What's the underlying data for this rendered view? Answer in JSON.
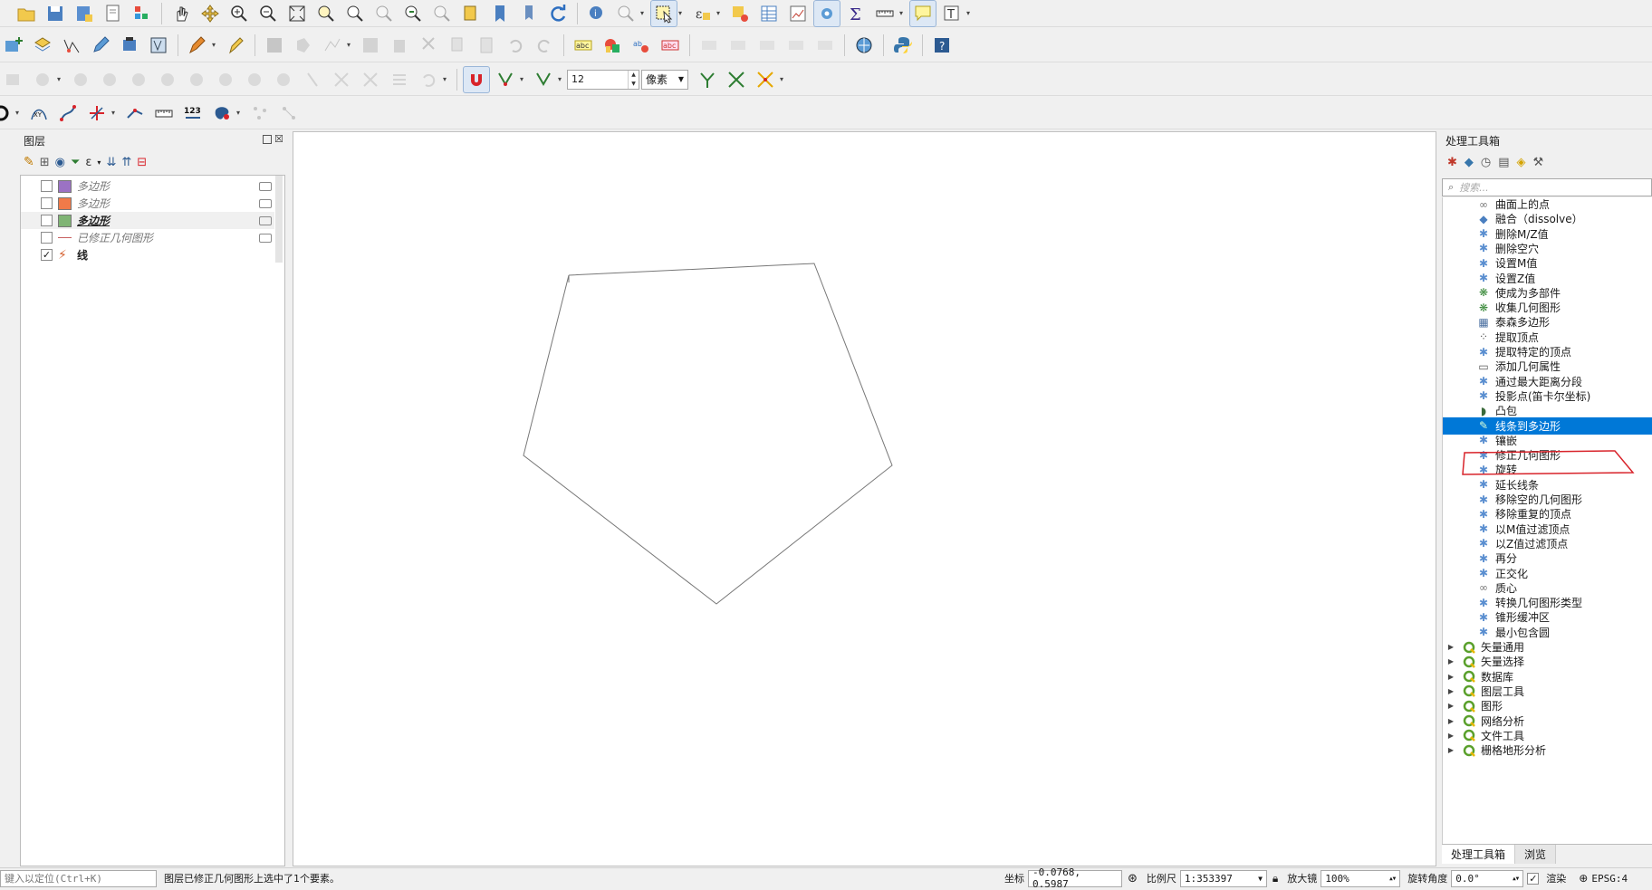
{
  "toolbar": {
    "snap_tolerance": "12",
    "snap_unit": "像素"
  },
  "layers_panel": {
    "title": "图层",
    "layers": [
      {
        "name": "多边形",
        "checked": false,
        "color": "#9b72c4",
        "style": "italic"
      },
      {
        "name": "多边形",
        "checked": false,
        "color": "#f07a49",
        "style": "italic"
      },
      {
        "name": "多边形",
        "checked": false,
        "color": "#7fb474",
        "style": "bold"
      },
      {
        "name": "已修正几何图形",
        "checked": false,
        "color": "#c86060",
        "style": "italic-line"
      },
      {
        "name": "线",
        "checked": true,
        "color": "#d45f2e",
        "style": "solid"
      }
    ]
  },
  "processing": {
    "title": "处理工具箱",
    "search_placeholder": "搜索...",
    "algorithms": [
      {
        "label": "曲面上的点",
        "icon": "chain-icon"
      },
      {
        "label": "融合（dissolve）",
        "icon": "dissolve-icon"
      },
      {
        "label": "删除M/Z值",
        "icon": "gear-icon"
      },
      {
        "label": "删除空穴",
        "icon": "gear-icon"
      },
      {
        "label": "设置M值",
        "icon": "gear-icon"
      },
      {
        "label": "设置Z值",
        "icon": "gear-icon"
      },
      {
        "label": "使成为多部件",
        "icon": "multipart-icon"
      },
      {
        "label": "收集几何图形",
        "icon": "collect-icon"
      },
      {
        "label": "泰森多边形",
        "icon": "voronoi-icon"
      },
      {
        "label": "提取顶点",
        "icon": "vertices-icon"
      },
      {
        "label": "提取特定的顶点",
        "icon": "gear-icon"
      },
      {
        "label": "添加几何属性",
        "icon": "attribute-icon"
      },
      {
        "label": "通过最大距离分段",
        "icon": "gear-icon"
      },
      {
        "label": "投影点(笛卡尔坐标)",
        "icon": "gear-icon"
      },
      {
        "label": "凸包",
        "icon": "convex-hull-icon"
      },
      {
        "label": "线条到多边形",
        "icon": "lines-to-polygon-icon",
        "selected": true
      },
      {
        "label": "镶嵌",
        "icon": "gear-icon"
      },
      {
        "label": "修正几何图形",
        "icon": "gear-icon"
      },
      {
        "label": "旋转",
        "icon": "gear-icon"
      },
      {
        "label": "延长线条",
        "icon": "gear-icon"
      },
      {
        "label": "移除空的几何图形",
        "icon": "gear-icon"
      },
      {
        "label": "移除重复的顶点",
        "icon": "gear-icon"
      },
      {
        "label": "以M值过滤顶点",
        "icon": "gear-icon"
      },
      {
        "label": "以Z值过滤顶点",
        "icon": "gear-icon"
      },
      {
        "label": "再分",
        "icon": "gear-icon"
      },
      {
        "label": "正交化",
        "icon": "gear-icon"
      },
      {
        "label": "质心",
        "icon": "chain-icon"
      },
      {
        "label": "转换几何图形类型",
        "icon": "gear-icon"
      },
      {
        "label": "锥形缓冲区",
        "icon": "gear-icon"
      },
      {
        "label": "最小包含圆",
        "icon": "gear-icon"
      }
    ],
    "groups": [
      {
        "label": "矢量通用"
      },
      {
        "label": "矢量选择"
      },
      {
        "label": "数据库"
      },
      {
        "label": "图层工具"
      },
      {
        "label": "图形"
      },
      {
        "label": "网络分析"
      },
      {
        "label": "文件工具"
      },
      {
        "label": "栅格地形分析"
      }
    ],
    "tabs": [
      "处理工具箱",
      "浏览"
    ]
  },
  "statusbar": {
    "locate_placeholder": "键入以定位(Ctrl+K)",
    "message": "图层已修正几何图形上选中了1个要素。",
    "coord_label": "坐标",
    "coord_value": "-0.0768, 0.5987",
    "scale_label": "比例尺",
    "scale_value": "1:353397",
    "magnifier_label": "放大镜",
    "magnifier_value": "100%",
    "rotation_label": "旋转角度",
    "rotation_value": "0.0°",
    "render_label": "渲染",
    "crs": "EPSG:4"
  },
  "colors": {
    "selection": "#0078d7",
    "annotation": "#d8232a"
  }
}
